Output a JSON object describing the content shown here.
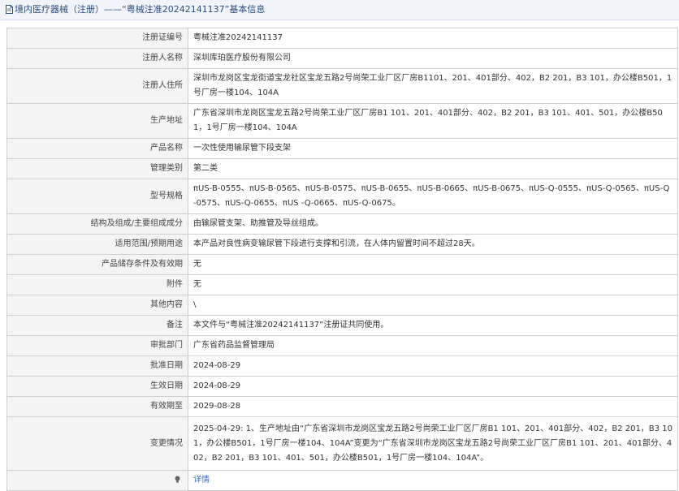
{
  "header": {
    "icon": "document-icon",
    "title": "境内医疗器械（注册）——“粤械注准20242141137”基本信息"
  },
  "table": {
    "rows": [
      {
        "key": "reg-number",
        "label": "注册证编号",
        "value": "粤械注准20242141137"
      },
      {
        "key": "registrant-name",
        "label": "注册人名称",
        "value": "深圳库珀医疗股份有限公司"
      },
      {
        "key": "registrant-address",
        "label": "注册人住所",
        "value": "深圳市龙岗区宝龙街道宝龙社区宝龙五路2号尚荣工业厂区厂房B1101、201、401部分、402，B2 201，B3 101，办公楼B501，1号厂房一楼104、104A"
      },
      {
        "key": "production-address",
        "label": "生产地址",
        "value": "广东省深圳市龙岗区宝龙五路2号尚荣工业厂区厂房B1 101、201、401部分、402，B2 201，B3 101、401、501，办公楼B501，1号厂房一楼104、104A"
      },
      {
        "key": "product-name",
        "label": "产品名称",
        "value": "一次性使用输尿管下段支架"
      },
      {
        "key": "management-class",
        "label": "管理类别",
        "value": "第二类"
      },
      {
        "key": "model-spec",
        "label": "型号规格",
        "value": "πUS-B-0555、πUS-B-0565、πUS-B-0575、πUS-B-0655、πUS-B-0665、πUS-B-0675、πUS-Q-0555、πUS-Q-0565、πUS-Q-0575、πUS-Q-0655、πUS -Q-0665、πUS-Q-0675。"
      },
      {
        "key": "structure",
        "label": "结构及组成/主要组成成分",
        "value": "由输尿管支架、助推管及导丝组成。"
      },
      {
        "key": "scope",
        "label": "适用范围/预期用途",
        "value": "本产品对良性病变输尿管下段进行支撑和引流，在人体内留置时间不超过28天。"
      },
      {
        "key": "storage",
        "label": "产品储存条件及有效期",
        "value": "无"
      },
      {
        "key": "attachment",
        "label": "附件",
        "value": "无"
      },
      {
        "key": "other",
        "label": "其他内容",
        "value": "\\"
      },
      {
        "key": "remarks",
        "label": "备注",
        "value": "本文件与“粤械注准20242141137”注册证共同使用。"
      },
      {
        "key": "approval-dept",
        "label": "审批部门",
        "value": "广东省药品监督管理局"
      },
      {
        "key": "approval-date",
        "label": "批准日期",
        "value": "2024-08-29"
      },
      {
        "key": "effective-date",
        "label": "生效日期",
        "value": "2024-08-29"
      },
      {
        "key": "expiry-date",
        "label": "有效期至",
        "value": "2029-08-28"
      },
      {
        "key": "change-history",
        "label": "变更情况",
        "value": "2025-04-29: 1、生产地址由“广东省深圳市龙岗区宝龙五路2号尚荣工业厂区厂房B1 101、201、401部分、402，B2 201，B3 101，办公楼B501，1号厂房一楼104、104A”变更为“广东省深圳市龙岗区宝龙五路2号尚荣工业厂区厂房B1 101、201、401部分、402，B2 201，B3 101、401、501，办公楼B501，1号厂房一楼104、104A”。"
      }
    ],
    "footer": {
      "icon": "lightbulb-icon",
      "link_text": "详情"
    }
  },
  "colors": {
    "accent": "#2b4d7e",
    "link": "#3b6db5",
    "label_bg": "#f4f4f4",
    "border": "#cfcfcf"
  }
}
